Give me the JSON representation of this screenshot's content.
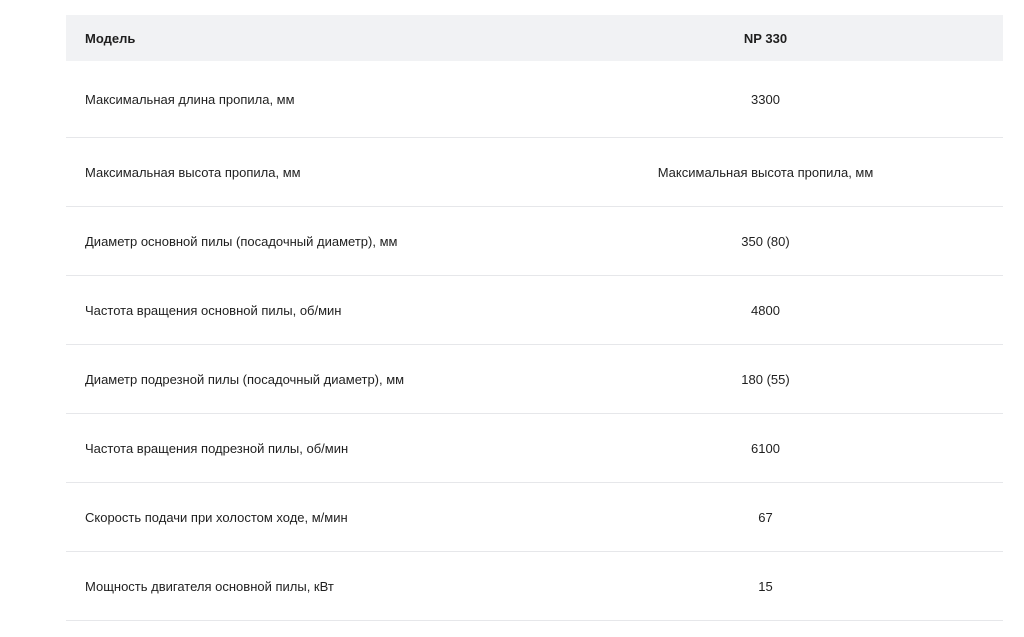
{
  "table": {
    "header": {
      "label": "Модель",
      "value": "NP 330"
    },
    "rows": [
      {
        "label": "Максимальная длина пропила, мм",
        "value": "3300"
      },
      {
        "label": "Максимальная высота пропила, мм",
        "value": "Максимальная высота пропила, мм"
      },
      {
        "label": "Диаметр основной пилы (посадочный диаметр), мм",
        "value": "350 (80)"
      },
      {
        "label": "Частота вращения основной пилы, об/мин",
        "value": "4800"
      },
      {
        "label": "Диаметр подрезной пилы (посадочный диаметр), мм",
        "value": "180 (55)"
      },
      {
        "label": "Частота вращения подрезной пилы, об/мин",
        "value": "6100"
      },
      {
        "label": "Скорость подачи при холостом ходе, м/мин",
        "value": "67"
      },
      {
        "label": "Мощность двигателя основной пилы, кВт",
        "value": "15"
      }
    ]
  }
}
